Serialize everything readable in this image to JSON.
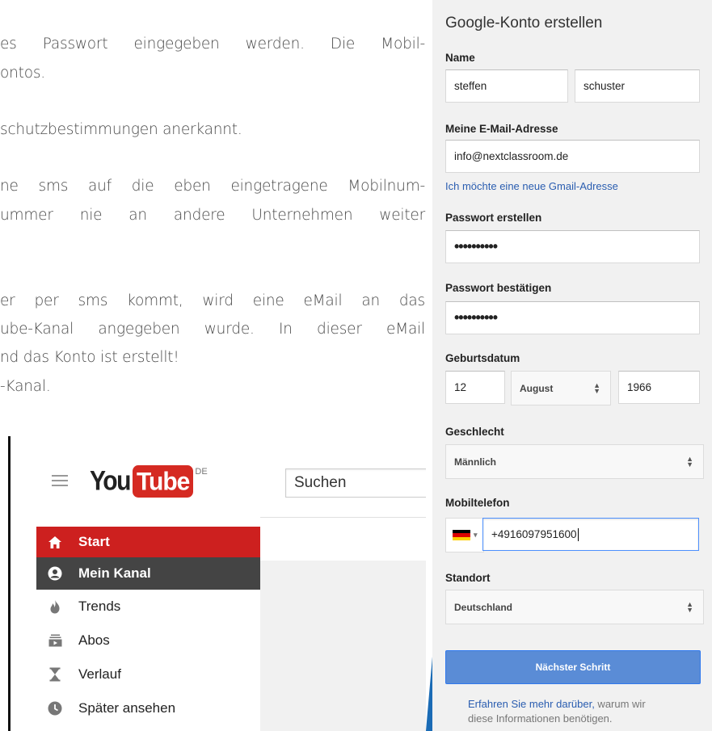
{
  "document": {
    "lines": [
      "es Passwort eingegeben werden. Die Mobil-",
      "ontos.",
      "schutzbestimmungen anerkannt.",
      "ne sms auf die eben eingetragene Mobilnum-",
      "ummer nie an andere Unternehmen weiter",
      "er per sms kommt, wird eine eMail an das",
      "ube-Kanal angegeben wurde. In dieser eMail",
      "nd das Konto ist erstellt!",
      "-Kanal."
    ]
  },
  "youtube": {
    "logo_you": "You",
    "logo_tube": "Tube",
    "logo_country": "DE",
    "search_placeholder": "Suchen",
    "nav": [
      {
        "label": "Start",
        "icon": "home-icon"
      },
      {
        "label": "Mein Kanal",
        "icon": "account-icon"
      },
      {
        "label": "Trends",
        "icon": "flame-icon"
      },
      {
        "label": "Abos",
        "icon": "subscriptions-icon"
      },
      {
        "label": "Verlauf",
        "icon": "hourglass-icon"
      },
      {
        "label": "Später ansehen",
        "icon": "clock-icon"
      }
    ],
    "colors": {
      "brand_red": "#cd201f",
      "selected_gray": "#444444"
    }
  },
  "signup": {
    "title": "Google-Konto erstellen",
    "name_label": "Name",
    "first_name": "steffen",
    "last_name": "schuster",
    "email_label": "Meine E-Mail-Adresse",
    "email": "info@nextclassroom.de",
    "new_gmail_link": "Ich möchte eine neue Gmail-Adresse",
    "password_label": "Passwort erstellen",
    "password_mask": "••••••••••",
    "confirm_label": "Passwort bestätigen",
    "confirm_mask": "••••••••••",
    "birthdate_label": "Geburtsdatum",
    "birth_day": "12",
    "birth_month": "August",
    "birth_year": "1966",
    "gender_label": "Geschlecht",
    "gender": "Männlich",
    "phone_label": "Mobiltelefon",
    "phone": "+4916097951600",
    "location_label": "Standort",
    "location": "Deutschland",
    "next_button": "Nächster Schritt",
    "footer_link": "Erfahren Sie mehr darüber,",
    "footer_text_1": " warum wir",
    "footer_text_2": "diese Informationen benötigen.",
    "colors": {
      "button_blue": "#5a8cd6",
      "link_blue": "#2a5db0",
      "focus_blue": "#4d90fe"
    }
  }
}
